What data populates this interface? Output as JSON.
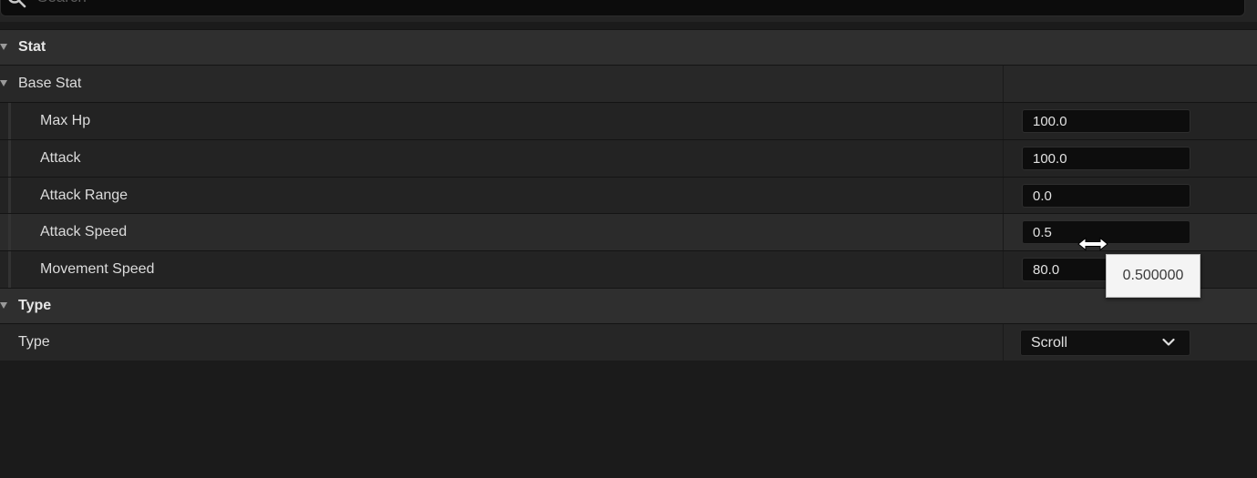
{
  "search": {
    "placeholder": "Search"
  },
  "categories": [
    {
      "label": "Stat"
    },
    {
      "label": "Type"
    }
  ],
  "stat": {
    "subcategory": "Base Stat",
    "properties": [
      {
        "label": "Max Hp",
        "value": "100.0"
      },
      {
        "label": "Attack",
        "value": "100.0"
      },
      {
        "label": "Attack Range",
        "value": "0.0"
      },
      {
        "label": "Attack Speed",
        "value": "0.5"
      },
      {
        "label": "Movement Speed",
        "value": "80.0"
      }
    ]
  },
  "type": {
    "property_label": "Type",
    "selected": "Scroll"
  },
  "tooltip": {
    "text": "0.500000"
  },
  "icons": {
    "search": "search-icon",
    "expand": "triangle-down-icon",
    "dropdown": "chevron-down-icon",
    "cursor": "horizontal-resize-cursor-icon"
  },
  "colors": {
    "background": "#1b1b1b",
    "category_header": "#2f2f2f",
    "field_background": "#0d0d0d",
    "tooltip_background": "#f4f4f4"
  }
}
